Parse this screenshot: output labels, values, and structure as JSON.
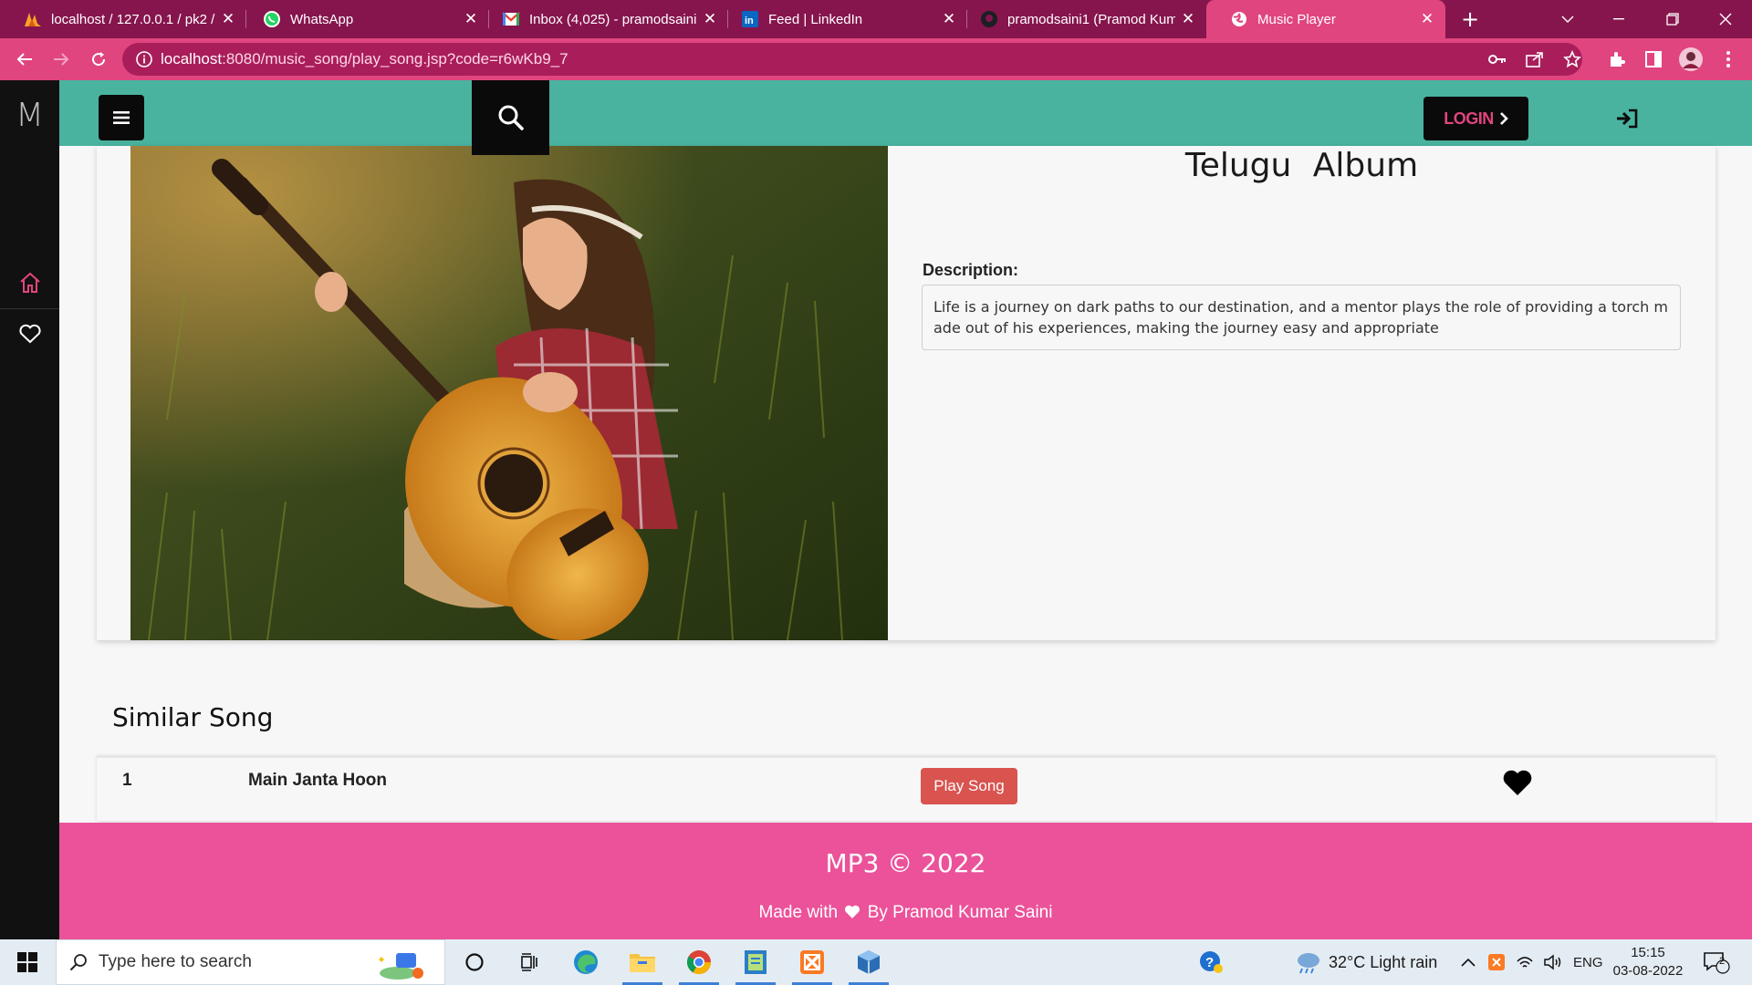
{
  "browser": {
    "tabs": [
      {
        "title": "localhost / 127.0.0.1 / pk2 /",
        "icon": "phpmyadmin-icon",
        "active": false
      },
      {
        "title": "WhatsApp",
        "icon": "whatsapp-icon",
        "active": false
      },
      {
        "title": "Inbox (4,025) - pramodsaini",
        "icon": "gmail-icon",
        "active": false
      },
      {
        "title": "Feed | LinkedIn",
        "icon": "linkedin-icon",
        "active": false
      },
      {
        "title": "pramodsaini1 (Pramod Kum",
        "icon": "github-icon",
        "active": false
      },
      {
        "title": "Music Player",
        "icon": "globe-icon",
        "active": true
      }
    ],
    "url_host": "localhost",
    "url_rest": ":8080/music_song/play_song.jsp?code=r6wKb9_7"
  },
  "app": {
    "logo": "M",
    "login_label": "LOGIN",
    "album_title": "Telugu  Album",
    "description_label": "Description:",
    "description": "Life is a journey on dark paths to our destination, and a mentor plays the role of providing a torch made out of his experiences, making the journey easy and appropriate",
    "similar_heading": "Similar Song",
    "songs": [
      {
        "number": "1",
        "name": "Main Janta Hoon",
        "play_label": "Play Song"
      }
    ],
    "footer_copyright": "MP3 © 2022",
    "footer_made_prefix": "Made with",
    "footer_made_suffix": "By Pramod Kumar Saini"
  },
  "taskbar": {
    "search_placeholder": "Type here to search",
    "weather": "32°C  Light rain",
    "language": "ENG",
    "time": "15:15",
    "date": "03-08-2022",
    "notification_count": "2"
  },
  "colors": {
    "tab_strip": "#86154d",
    "address_bar": "#e0457f",
    "header": "#49b3a0",
    "footer": "#eb529a",
    "sidebar": "#111111",
    "play_button": "#d9534f"
  }
}
